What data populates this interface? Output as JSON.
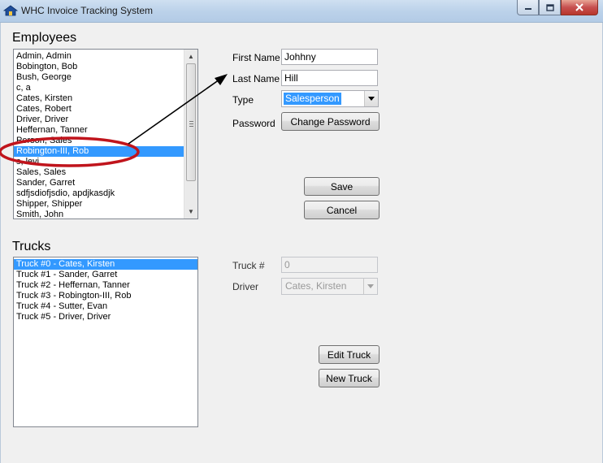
{
  "window": {
    "title": "WHC Invoice Tracking System",
    "icon": "house-icon",
    "controls": [
      "minimize-icon",
      "maximize-icon",
      "close-icon"
    ]
  },
  "employees": {
    "section_title": "Employees",
    "items": [
      "Admin, Admin",
      "Bobington, Bob",
      "Bush, George",
      "c, a",
      "Cates, Kirsten",
      "Cates, Robert",
      "Driver, Driver",
      "Heffernan, Tanner",
      "Person, Sales",
      "Robington-III, Rob",
      "s, levi",
      "Sales, Sales",
      "Sander, Garret",
      "sdfjsdiofjsdio, apdjkasdjk",
      "Shipper, Shipper",
      "Smith, John"
    ],
    "selected_index": 9
  },
  "employee_form": {
    "first_name_label": "First Name",
    "first_name_value": "Johhny",
    "last_name_label": "Last Name",
    "last_name_value": "Hill",
    "type_label": "Type",
    "type_value": "Salesperson",
    "password_label": "Password",
    "change_password_button": "Change Password",
    "save_button": "Save",
    "cancel_button": "Cancel"
  },
  "trucks": {
    "section_title": "Trucks",
    "items": [
      "Truck #0 - Cates, Kirsten",
      "Truck #1 - Sander, Garret",
      "Truck #2 - Heffernan, Tanner",
      "Truck #3 - Robington-III, Rob",
      "Truck #4 - Sutter, Evan",
      "Truck #5 - Driver, Driver"
    ],
    "selected_index": 0
  },
  "truck_form": {
    "truck_number_label": "Truck #",
    "truck_number_value": "0",
    "driver_label": "Driver",
    "driver_value": "Cates, Kirsten",
    "edit_truck_button": "Edit Truck",
    "new_truck_button": "New Truck"
  },
  "colors": {
    "selection": "#3399ff",
    "annotation_ellipse": "#c0141c",
    "annotation_arrow": "#000000"
  }
}
